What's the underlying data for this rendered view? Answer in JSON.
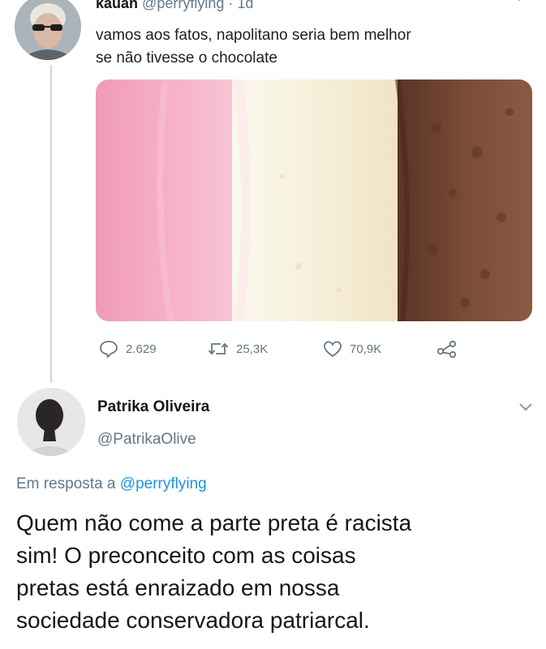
{
  "tweet1": {
    "name": "kauan",
    "handle": "@perryflying",
    "separator": "·",
    "time": "1d",
    "text_lines": [
      "vamos aos fatos, napolitano seria bem melhor",
      "se não tivesse o chocolate"
    ],
    "actions": {
      "replies": "2.629",
      "retweets": "25,3K",
      "likes": "70,9K"
    }
  },
  "tweet2": {
    "name": "Patrika Oliveira",
    "handle": "@PatrikaOlive",
    "reply_prefix": "Em resposta a",
    "reply_handle": "@perryflying",
    "text_lines": [
      "Quem não come a parte preta é racista",
      "sim! O preconceito com as coisas",
      "pretas está enraizado em nossa",
      "sociedade conservadora patriarcal."
    ]
  },
  "colors": {
    "text": "#14171a",
    "secondary": "#657786",
    "link": "#1b95e0",
    "thread_line": "#ccd6dd",
    "pink": "#f4a6c0",
    "vanilla": "#f7f1de",
    "chocolate": "#6e4331"
  },
  "icons": [
    "reply-icon",
    "retweet-icon",
    "like-icon",
    "share-icon",
    "chevron-down-icon"
  ]
}
